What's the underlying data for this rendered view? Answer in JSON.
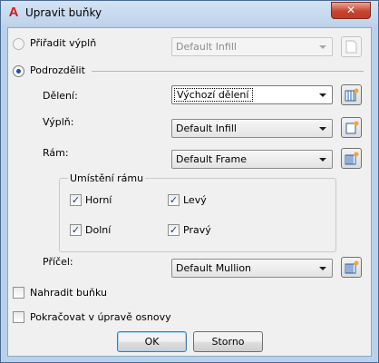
{
  "window": {
    "title": "Upravit buňky",
    "app_icon_glyph": "A",
    "close_glyph": "✕"
  },
  "assign_infill": {
    "label": "Přiřadit výplň",
    "selected": false,
    "enabled": true,
    "dropdown_value": "Default Infill",
    "dropdown_enabled": false
  },
  "subdivide": {
    "label": "Podrozdělit",
    "selected": true,
    "division": {
      "label": "Dělení:",
      "value": "Výchozí dělení"
    },
    "infill": {
      "label": "Výplň:",
      "value": "Default Infill"
    },
    "frame": {
      "label": "Rám:",
      "value": "Default Frame"
    },
    "frame_placement": {
      "title": "Umístění rámu",
      "top": {
        "label": "Horní",
        "checked": true
      },
      "left": {
        "label": "Levý",
        "checked": true
      },
      "bottom": {
        "label": "Dolní",
        "checked": true
      },
      "right": {
        "label": "Pravý",
        "checked": true
      }
    },
    "mullion": {
      "label": "Příčel:",
      "value": "Default Mullion"
    }
  },
  "replace_cell": {
    "label": "Nahradit buňku",
    "checked": false
  },
  "continue_editing": {
    "label": "Pokračovat v úpravě osnovy",
    "checked": false
  },
  "buttons": {
    "ok": "OK",
    "cancel": "Storno"
  },
  "check_glyph": "✓",
  "colors": {
    "accent": "#1c4f9c",
    "close": "#c6452f",
    "titlebar": "#bed3ea"
  }
}
